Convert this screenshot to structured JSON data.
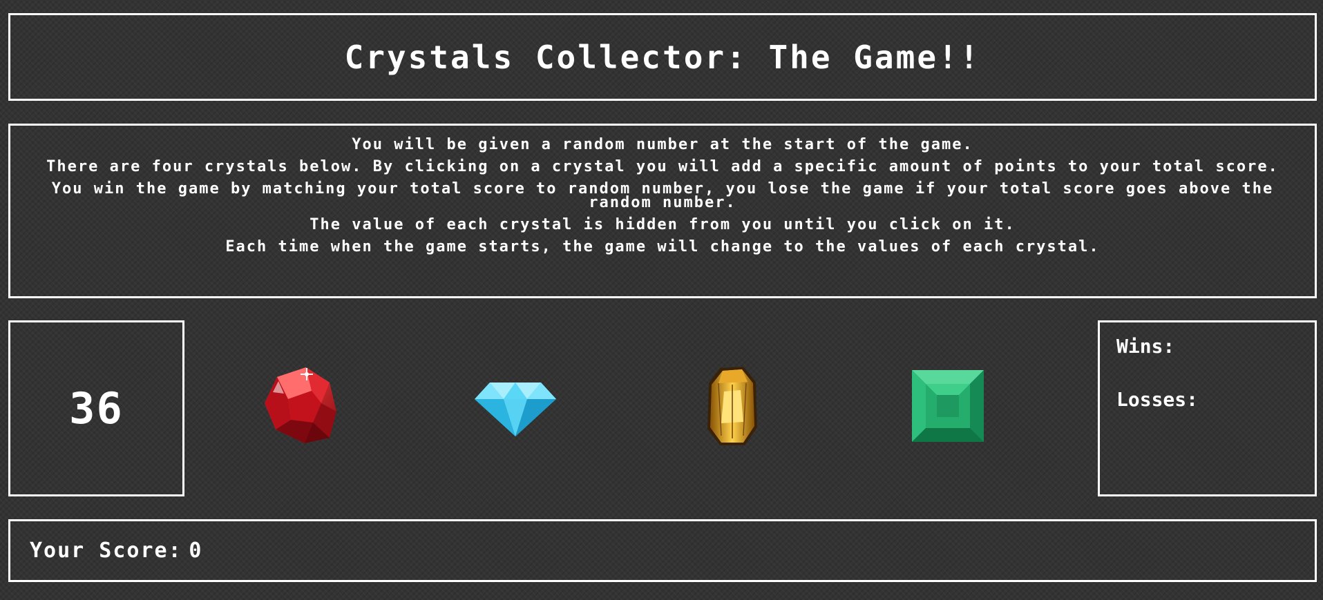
{
  "title": "Crystals Collector: The Game!!",
  "instructions": [
    "You will be given a random number at the start of the game.",
    "There are four crystals below. By clicking on a crystal you will add a specific amount of points to your total score.",
    "You win the game by matching your total score to random number, you lose the game if your total score goes above the random number.",
    "The value of each crystal is hidden from you until you click on it.",
    "Each time when the game starts, the game will change to the values of each crystal."
  ],
  "target_number": "36",
  "stats": {
    "wins_label": "Wins:",
    "losses_label": "Losses:"
  },
  "score": {
    "label": "Your Score:",
    "value": "0"
  },
  "crystals": [
    {
      "icon": "red-ruby-icon",
      "color": "#d11a24"
    },
    {
      "icon": "blue-diamond-icon",
      "color": "#3fd0f0"
    },
    {
      "icon": "yellow-topaz-icon",
      "color": "#e0a21c"
    },
    {
      "icon": "green-emerald-icon",
      "color": "#2bb47a"
    }
  ]
}
